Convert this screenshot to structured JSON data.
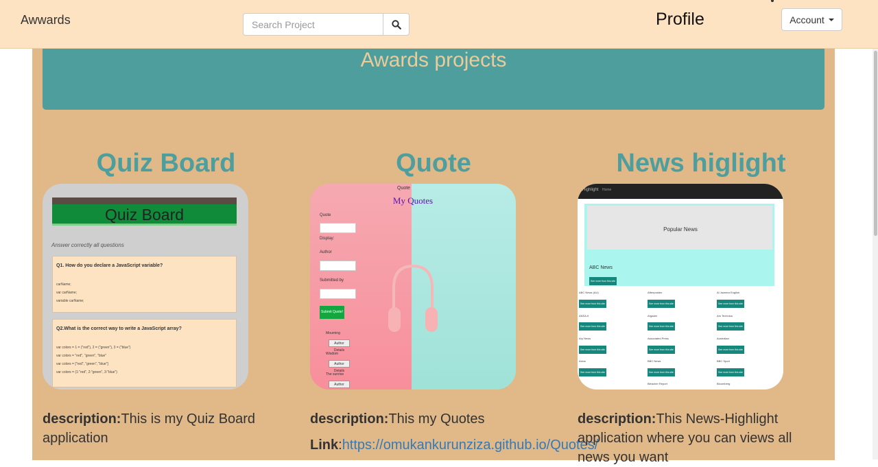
{
  "navbar": {
    "brand": "Awwards",
    "search_placeholder": "Search Project",
    "profile": "Profile",
    "account": "Account"
  },
  "jumbotron": {
    "title": "Awards projects"
  },
  "projects": [
    {
      "title": "Quiz Board",
      "desc_label": "description:",
      "desc_text": "This is my Quiz Board application"
    },
    {
      "title": "Quote",
      "desc_label": "description:",
      "desc_text": "This my Quotes",
      "link_label": "Link",
      "link_url": "https://omukankurunziza.github.io/Quotes/"
    },
    {
      "title": "News higlight",
      "desc_label": "description:",
      "desc_text": "This News-Highlight application where you can views all news you want"
    }
  ],
  "quiz_thumb": {
    "title": "Quiz Board",
    "subtitle": "Answer correctly all questions",
    "q1": "Q1. How do you declare a JavaScript variable?",
    "q1_opts": [
      "carName;",
      "var carName;",
      "variable carName;"
    ],
    "q2": "Q2.What is the correct way to write a JavaScript array?",
    "q2_opts": [
      "var colors = 1 = (\"red\"), 2 = (\"green\"), 3 = (\"blue\")",
      "var colors = \"red\", \"green\", \"blue\"",
      "var colors = [\"red\", \"green\", \"blue\"]",
      "var colors = (1:\"red\", 2:\"green\", 3:\"blue\")"
    ]
  },
  "quote_thumb": {
    "head": "Quote",
    "title": "My Quotes",
    "labels": [
      "Quote",
      "Display:",
      "Author",
      "Submitted by"
    ],
    "submit": "Submit Quote!",
    "items": [
      "Mourning",
      "Wisdom",
      "The sunrise"
    ],
    "details": "Author Details"
  },
  "news_thumb": {
    "brand": "Highlight",
    "home": "Home",
    "popular": "Popular News",
    "abc": "ABC News",
    "see_more": "See more from this site",
    "sources": [
      "ABC News (AU)",
      "Aftenposten",
      "Al Jazeera English",
      "ANSA.it",
      "Argaam",
      "Ars Technica",
      "Ary News",
      "Associated Press",
      "Australian",
      "Axios",
      "BBC News",
      "BBC Sport",
      "Bleacher Report",
      "Bloomberg"
    ]
  }
}
